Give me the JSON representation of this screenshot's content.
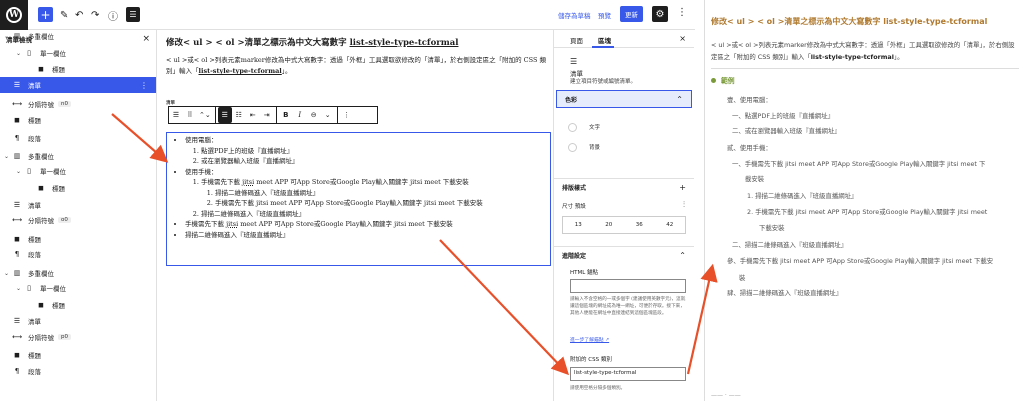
{
  "topbar": {
    "logo_glyph": "W",
    "add_glyph": "+",
    "pen_glyph": "✎",
    "undo_glyph": "↶",
    "redo_glyph": "↷",
    "info_glyph": "ⓘ",
    "listview_glyph": "☰",
    "save_draft": "儲存為草稿",
    "preview": "預覽",
    "update": "更新",
    "settings_glyph": "⚙",
    "more_glyph": "⋮"
  },
  "listview": {
    "title": "清單檢視",
    "close_glyph": "×",
    "rows": [
      {
        "chev": "⌄",
        "icon": "▥",
        "label": "多重欄位",
        "anchor": ""
      },
      {
        "chev": "⌄",
        "icon": "▯",
        "label": "單一欄位",
        "anchor": ""
      },
      {
        "chev": "",
        "icon": "◼",
        "label": "標題",
        "anchor": ""
      },
      {
        "chev": "",
        "icon": "☰",
        "label": "清單",
        "anchor": ""
      },
      {
        "chev": "",
        "icon": "⟷",
        "label": "分隔符號",
        "anchor": "n0"
      },
      {
        "chev": "",
        "icon": "◼",
        "label": "標題",
        "anchor": ""
      },
      {
        "chev": "",
        "icon": "¶",
        "label": "段落",
        "anchor": ""
      },
      {
        "chev": "⌄",
        "icon": "▥",
        "label": "多重欄位",
        "anchor": ""
      },
      {
        "chev": "⌄",
        "icon": "▯",
        "label": "單一欄位",
        "anchor": ""
      },
      {
        "chev": "",
        "icon": "◼",
        "label": "標題",
        "anchor": ""
      },
      {
        "chev": "",
        "icon": "☰",
        "label": "清單",
        "anchor": ""
      },
      {
        "chev": "",
        "icon": "⟷",
        "label": "分隔符號",
        "anchor": "o0"
      },
      {
        "chev": "",
        "icon": "◼",
        "label": "標題",
        "anchor": ""
      },
      {
        "chev": "",
        "icon": "¶",
        "label": "段落",
        "anchor": ""
      },
      {
        "chev": "⌄",
        "icon": "▥",
        "label": "多重欄位",
        "anchor": ""
      },
      {
        "chev": "⌄",
        "icon": "▯",
        "label": "單一欄位",
        "anchor": ""
      },
      {
        "chev": "",
        "icon": "◼",
        "label": "標題",
        "anchor": ""
      },
      {
        "chev": "",
        "icon": "☰",
        "label": "清單",
        "anchor": ""
      },
      {
        "chev": "",
        "icon": "⟷",
        "label": "分隔符號",
        "anchor": "p0"
      },
      {
        "chev": "",
        "icon": "◼",
        "label": "標題",
        "anchor": ""
      },
      {
        "chev": "",
        "icon": "¶",
        "label": "段落",
        "anchor": ""
      }
    ],
    "selected_dots": "⋮"
  },
  "editor": {
    "title_prefix": "修改< ul > < ol >清單之標示為中文大寫數字 ",
    "title_link": "list-style-type-tcformal",
    "intro_part1": "< ul >或< ol >列表元素marker修改為中式大寫數字：透過「外框」工具選取欲修改的「清單」，於右側設定區之「附加的 CSS 類別」輸入「",
    "intro_class": "list-style-type-tcformal",
    "intro_part2": "」。",
    "block_tag": "清單",
    "toolbar": {
      "b1": "☰",
      "b2": "⠿",
      "b3": "⌃⌄",
      "b4": "☰",
      "b5": "☷",
      "b6": "⇤",
      "b7": "⇥",
      "bold": "B",
      "italic": "I",
      "link": "⊖",
      "chevron": "⌄",
      "more": "⋮"
    },
    "list": {
      "item1": "使用電腦：",
      "item1_sub": [
        "點選PDF上的班級『直播網址』",
        "或在瀏覽器輸入班級『直播網址』"
      ],
      "item2": "使用手機：",
      "item2_sub1_pre": "手機需先下載 ",
      "item2_sub1_u": "jitsi",
      "item2_sub1_post": " meet APP 可App Store或Google Play輸入關鍵字 jitsi meet 下載安裝",
      "item2_sub1_sub": [
        "掃描二維條碼進入『班級直播網址』",
        "手機需先下載 jitsi meet APP 可App Store或Google Play輸入關鍵字 jitsi meet 下載安裝"
      ],
      "item2_sub2": "掃描二維條碼進入『班級直播網址』",
      "item3_pre": "手機需先下載 ",
      "item3_u": "jitsi",
      "item3_post": " meet APP 可App Store或Google Play輸入關鍵字 jitsi meet 下載安裝",
      "item4": "掃描二維條碼進入『班級直播網址』"
    }
  },
  "settings": {
    "tab_page": "頁面",
    "tab_block": "區塊",
    "close_glyph": "×",
    "block_icon": "☰",
    "block_name": "清單",
    "block_desc": "建立項目符號或編號清單。",
    "color_title": "色彩",
    "color_chevron": "⌃",
    "color_text": "文字",
    "color_bg": "背景",
    "typo_title": "排版樣式",
    "typo_plus": "+",
    "size_label": "尺寸 預設",
    "size_tune_glyph": "⫶",
    "sizes": [
      "13",
      "20",
      "36",
      "42"
    ],
    "adv_title": "進階設定",
    "adv_chevron": "⌃",
    "anchor_label": "HTML 錨點",
    "anchor_help": "請輸入不含空格的一或多個字 (建議使用英數字元)，這就讓這個區塊的網址成為唯一網址，可便於存取。接下來，其他人便能在網址中直接連結到這個區塊區段。",
    "anchor_link": "進一步了解錨點 ↗",
    "css_label": "附加的 CSS 類別",
    "css_value": "list-style-type-tcformal",
    "css_help": "請使用空格分隔多個類別。"
  },
  "frontend": {
    "title": "修改< ul > < ol >清單之標示為中文大寫數字 list-style-type-tcformal",
    "intro_pre": "< ul >或< ol >列表元素marker修改為中式大寫數字：透過「外框」工具選取欲修改的「清單」，於右側設定區之「附加的 CSS 類別」輸入「",
    "intro_bold": "list-style-type-tcformal",
    "intro_post": "」。",
    "example": "範例",
    "lines": [
      "壹、使用電腦：",
      "一、點選PDF上的班級『直播網址』",
      "二、或在瀏覽器輸入班級『直播網址』",
      "貳、使用手機：",
      "一、手機需先下載 jitsi meet APP 可App Store或Google Play輸入關鍵字 jitsi meet 下",
      "載安裝",
      "1. 掃描二維條碼進入『班級直播網址』",
      "2. 手機需先下載 jitsi meet APP 可App Store或Google Play輸入關鍵字 jitsi meet",
      "下載安裝",
      "二、掃描二維條碼進入『班級直播網址』",
      "參、手機需先下載 jitsi meet APP 可App Store或Google Play輸入關鍵字 jitsi meet 下載安",
      "裝",
      "肆、掃描二維條碼進入『班級直播網址』"
    ],
    "bottom_hint": "—— · ——"
  },
  "colors": {
    "accent": "#3858e9",
    "arrow": "#e8502a",
    "frontend_title": "#b07a2f",
    "example_green": "#7a9a3a"
  }
}
